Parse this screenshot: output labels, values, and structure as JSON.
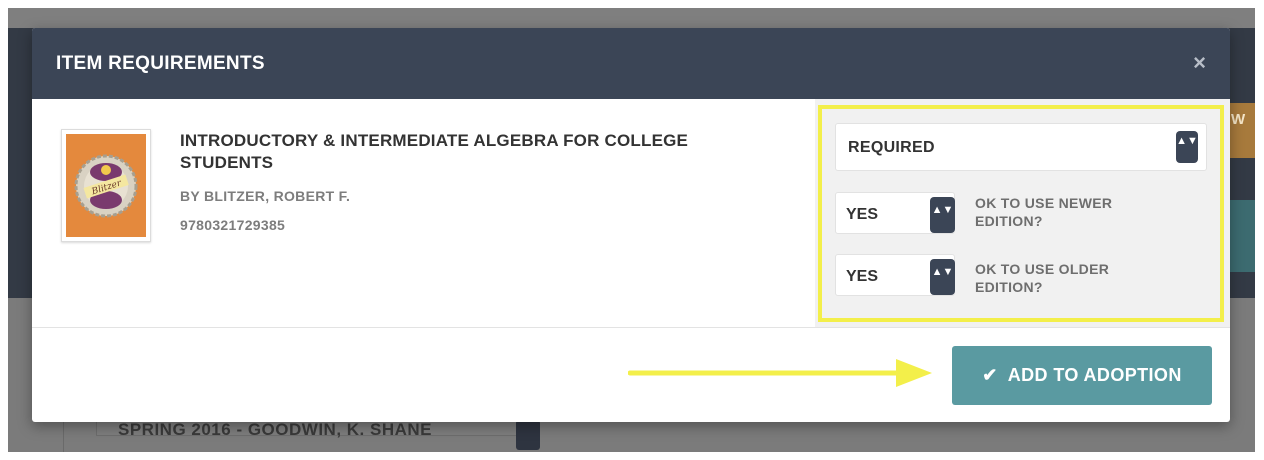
{
  "background": {
    "edge_label": "W",
    "select_text": "SPRING 2016 - GOODWIN, K. SHANE"
  },
  "modal": {
    "title": "ITEM REQUIREMENTS",
    "close_glyph": "×"
  },
  "item": {
    "cover_icon": "bottle-cap-blitzer-icon",
    "title": "INTRODUCTORY & INTERMEDIATE ALGEBRA FOR COLLEGE STUDENTS",
    "author": "BY BLITZER, ROBERT F.",
    "isbn": "9780321729385"
  },
  "options": {
    "requirement": "REQUIRED",
    "newer_edition": {
      "value": "YES",
      "caption": "OK TO USE NEWER EDITION?"
    },
    "older_edition": {
      "value": "YES",
      "caption": "OK TO USE OLDER EDITION?"
    },
    "spinner_glyph": "▲▼"
  },
  "footer": {
    "add_button_label": "ADD TO ADOPTION",
    "add_button_icon": "✔"
  },
  "colors": {
    "header": "#3b4556",
    "accent_teal": "#5a9aa1",
    "highlight_yellow": "#f3ef4a"
  }
}
